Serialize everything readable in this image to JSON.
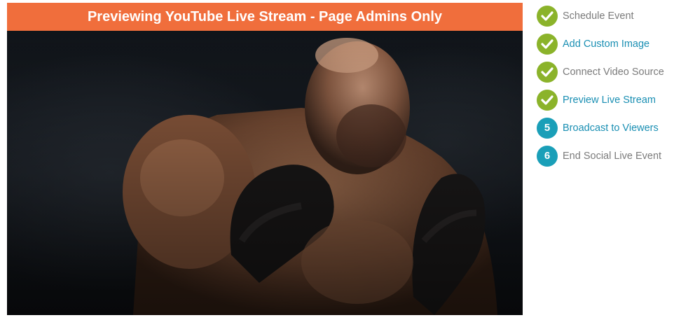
{
  "preview": {
    "banner_title": "Previewing YouTube Live Stream - Page Admins Only",
    "banner_color": "#f06e3c"
  },
  "steps": [
    {
      "status": "done",
      "label": "Schedule Event",
      "style": "muted"
    },
    {
      "status": "done",
      "label": "Add Custom Image",
      "style": "link"
    },
    {
      "status": "done",
      "label": "Connect Video Source",
      "style": "muted"
    },
    {
      "status": "done",
      "label": "Preview Live Stream",
      "style": "link"
    },
    {
      "status": "pending",
      "number": "5",
      "label": "Broadcast to Viewers",
      "style": "link"
    },
    {
      "status": "pending",
      "number": "6",
      "label": "End Social Live Event",
      "style": "muted"
    }
  ],
  "colors": {
    "done": "#8bb32a",
    "pending": "#1a9fb8",
    "link": "#1a8fb3",
    "muted": "#7b7b7b"
  },
  "icons": {
    "done": "checkmark-icon"
  }
}
